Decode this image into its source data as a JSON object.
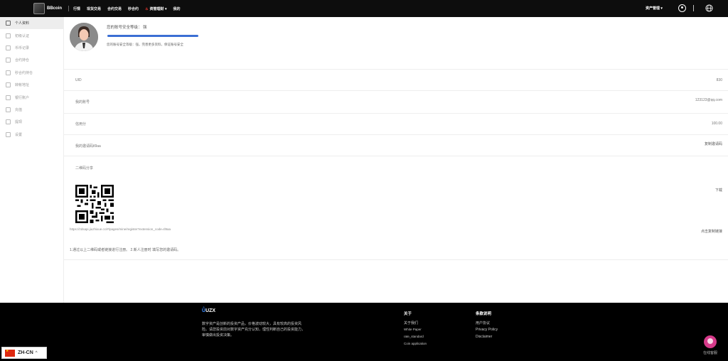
{
  "nav": {
    "brand": "BBcoin",
    "items": [
      "行情",
      "现货交易",
      "合约交易",
      "秒合约",
      "资管理财",
      "我的"
    ],
    "hot_item_caret": "▾",
    "asset_menu": "资产管理 ▾"
  },
  "sidebar": {
    "items": [
      {
        "label": "个人资料",
        "icon": "user-icon"
      },
      {
        "label": "初级认证",
        "icon": "id-card-icon"
      },
      {
        "label": "币币记录",
        "icon": "list-icon"
      },
      {
        "label": "合约持仓",
        "icon": "document-icon"
      },
      {
        "label": "秒合约持仓",
        "icon": "clock-icon"
      },
      {
        "label": "转帐地址",
        "icon": "dollar-icon"
      },
      {
        "label": "银行账户",
        "icon": "bank-card-icon"
      },
      {
        "label": "充值",
        "icon": "recharge-icon"
      },
      {
        "label": "提现",
        "icon": "lock-icon"
      },
      {
        "label": "设置",
        "icon": "gear-icon"
      }
    ]
  },
  "profile": {
    "security_label": "您的账号安全等级： 强",
    "security_level_percent": 100,
    "security_tip": "您的账号安全等级：强，完善更多资料，保证账号安全",
    "uid_label": "UID",
    "uid_value": "830",
    "account_label": "我的账号",
    "account_value": "123123@qq.com",
    "credit_label": "信用分",
    "credit_value": "100.00",
    "invite_label": "我的邀请码tl9aa",
    "copy_invite": "复制邀请码",
    "qr_share_label": "二维码分享",
    "download": "下载",
    "share_link": "https://zdsapi.jiuzhixue.cc/#/pages/mine/register?extension_code=tl9aa",
    "copy_link": "点击复制链接",
    "note": "1.通过以上二维码或者链接进行注册。 2.新人注册时 填写您的邀请码。"
  },
  "footer": {
    "brand": "UZX",
    "description": "数字资产是创新的投资产品，价格波动较大，具有较高的投资风险。请您投资前对数字资产充分认知，理性判断自己的投资能力，审慎做出投资决策。",
    "about_title": "关于",
    "about_items": [
      "关于我们",
      "White Paper",
      "rate_standard",
      "Coin application"
    ],
    "terms_title": "条款说明",
    "terms_items": [
      "用户协议",
      "Privacy Policy",
      "Disclaimer"
    ],
    "service_label": "在线客服"
  },
  "language": {
    "code": "ZH-CN",
    "caret": "^"
  }
}
